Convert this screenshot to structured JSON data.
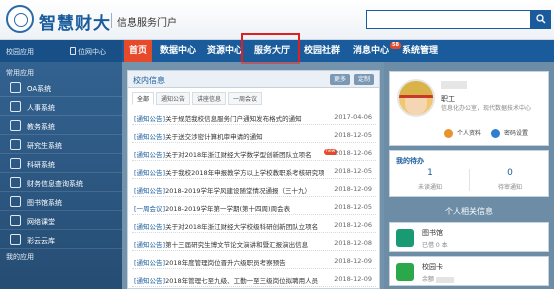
{
  "header": {
    "title": "智慧财大",
    "subtitle": "信息服务门户",
    "search": {
      "value": "",
      "icon": "search-icon"
    }
  },
  "nav": {
    "campus_label": "校园应用",
    "mobile_label": "位网中心",
    "items": [
      {
        "label": "首页",
        "active": true
      },
      {
        "label": "数据中心"
      },
      {
        "label": "资源中心"
      },
      {
        "label": "服务大厅"
      },
      {
        "label": "校园社群"
      },
      {
        "label": "消息中心",
        "badge": "58"
      },
      {
        "label": "系统管理"
      }
    ]
  },
  "sidebar": {
    "heading": "常用应用",
    "items": [
      {
        "label": "OA系统",
        "icon": "oa-icon"
      },
      {
        "label": "人事系统",
        "icon": "person-icon"
      },
      {
        "label": "教务系统",
        "icon": "book-icon"
      },
      {
        "label": "研究生系统",
        "icon": "graduate-icon"
      },
      {
        "label": "科研系统",
        "icon": "research-icon"
      },
      {
        "label": "财务信息查询系统",
        "icon": "finance-icon"
      },
      {
        "label": "图书馆系统",
        "icon": "library-icon"
      },
      {
        "label": "网络课堂",
        "icon": "classroom-icon"
      },
      {
        "label": "彩云云库",
        "icon": "cloud-icon"
      }
    ],
    "footer": "我的应用"
  },
  "news": {
    "title": "校内信息",
    "more_label": "更多",
    "custom_label": "定制",
    "tabs": [
      "全部",
      "通知公告",
      "讲座信息",
      "一周会议"
    ],
    "rows": [
      {
        "tag": "[通知公告]",
        "text": "关于规范我校信息服务门户通知发布格式的通知",
        "date": "2017-04-06"
      },
      {
        "tag": "[通知公告]",
        "text": "关于送交涉密计算机审申请的通知",
        "date": "2018-12-05"
      },
      {
        "tag": "[通知公告]",
        "text": "关于对2018年浙江财经大学数学型创新团队立项名",
        "date": "2018-12-06",
        "new": "new"
      },
      {
        "tag": "[通知公告]",
        "text": "关于我校2018年申报教学方以上学校教职系考核研究项目名",
        "date": "2018-12-05"
      },
      {
        "tag": "[通知公告]",
        "text": "2018-2019学年学风建设随堂情况通报（三十九）",
        "date": "2018-12-09"
      },
      {
        "tag": "[一周会议]",
        "text": "2018-2019学年第一学期(第十四周)周会表",
        "date": "2018-12-05"
      },
      {
        "tag": "[通知公告]",
        "text": "关于对2018年浙江财经大学校级科研创新团队立项名",
        "date": "2018-12-06"
      },
      {
        "tag": "[通知公告]",
        "text": "第十三届研究生博文节论文演讲和暨汇报演出信息",
        "date": "2018-12-08"
      },
      {
        "tag": "[通知公告]",
        "text": "2018年度管理岗位晋升六级职员考察预告",
        "date": "2018-12-09"
      },
      {
        "tag": "[通知公告]",
        "text": "2018年管理七至九级、工勤一至三级岗位拟聘用人员",
        "date": "2018-12-09"
      }
    ]
  },
  "profile": {
    "role": "职工",
    "desc": "信息化办公室，现代数据技术中心",
    "btn_profile": "个人资料",
    "btn_password": "密码设置"
  },
  "todo": {
    "title": "我的待办",
    "pending_value": "1",
    "pending_label": "未读通知",
    "done_value": "0",
    "done_label": "待审通知"
  },
  "personal": {
    "heading": "个人相关信息",
    "library": {
      "title": "图书馆",
      "sub": "已借 0 本"
    },
    "campus_card": {
      "title": "校园卡",
      "sub": "余额"
    }
  }
}
